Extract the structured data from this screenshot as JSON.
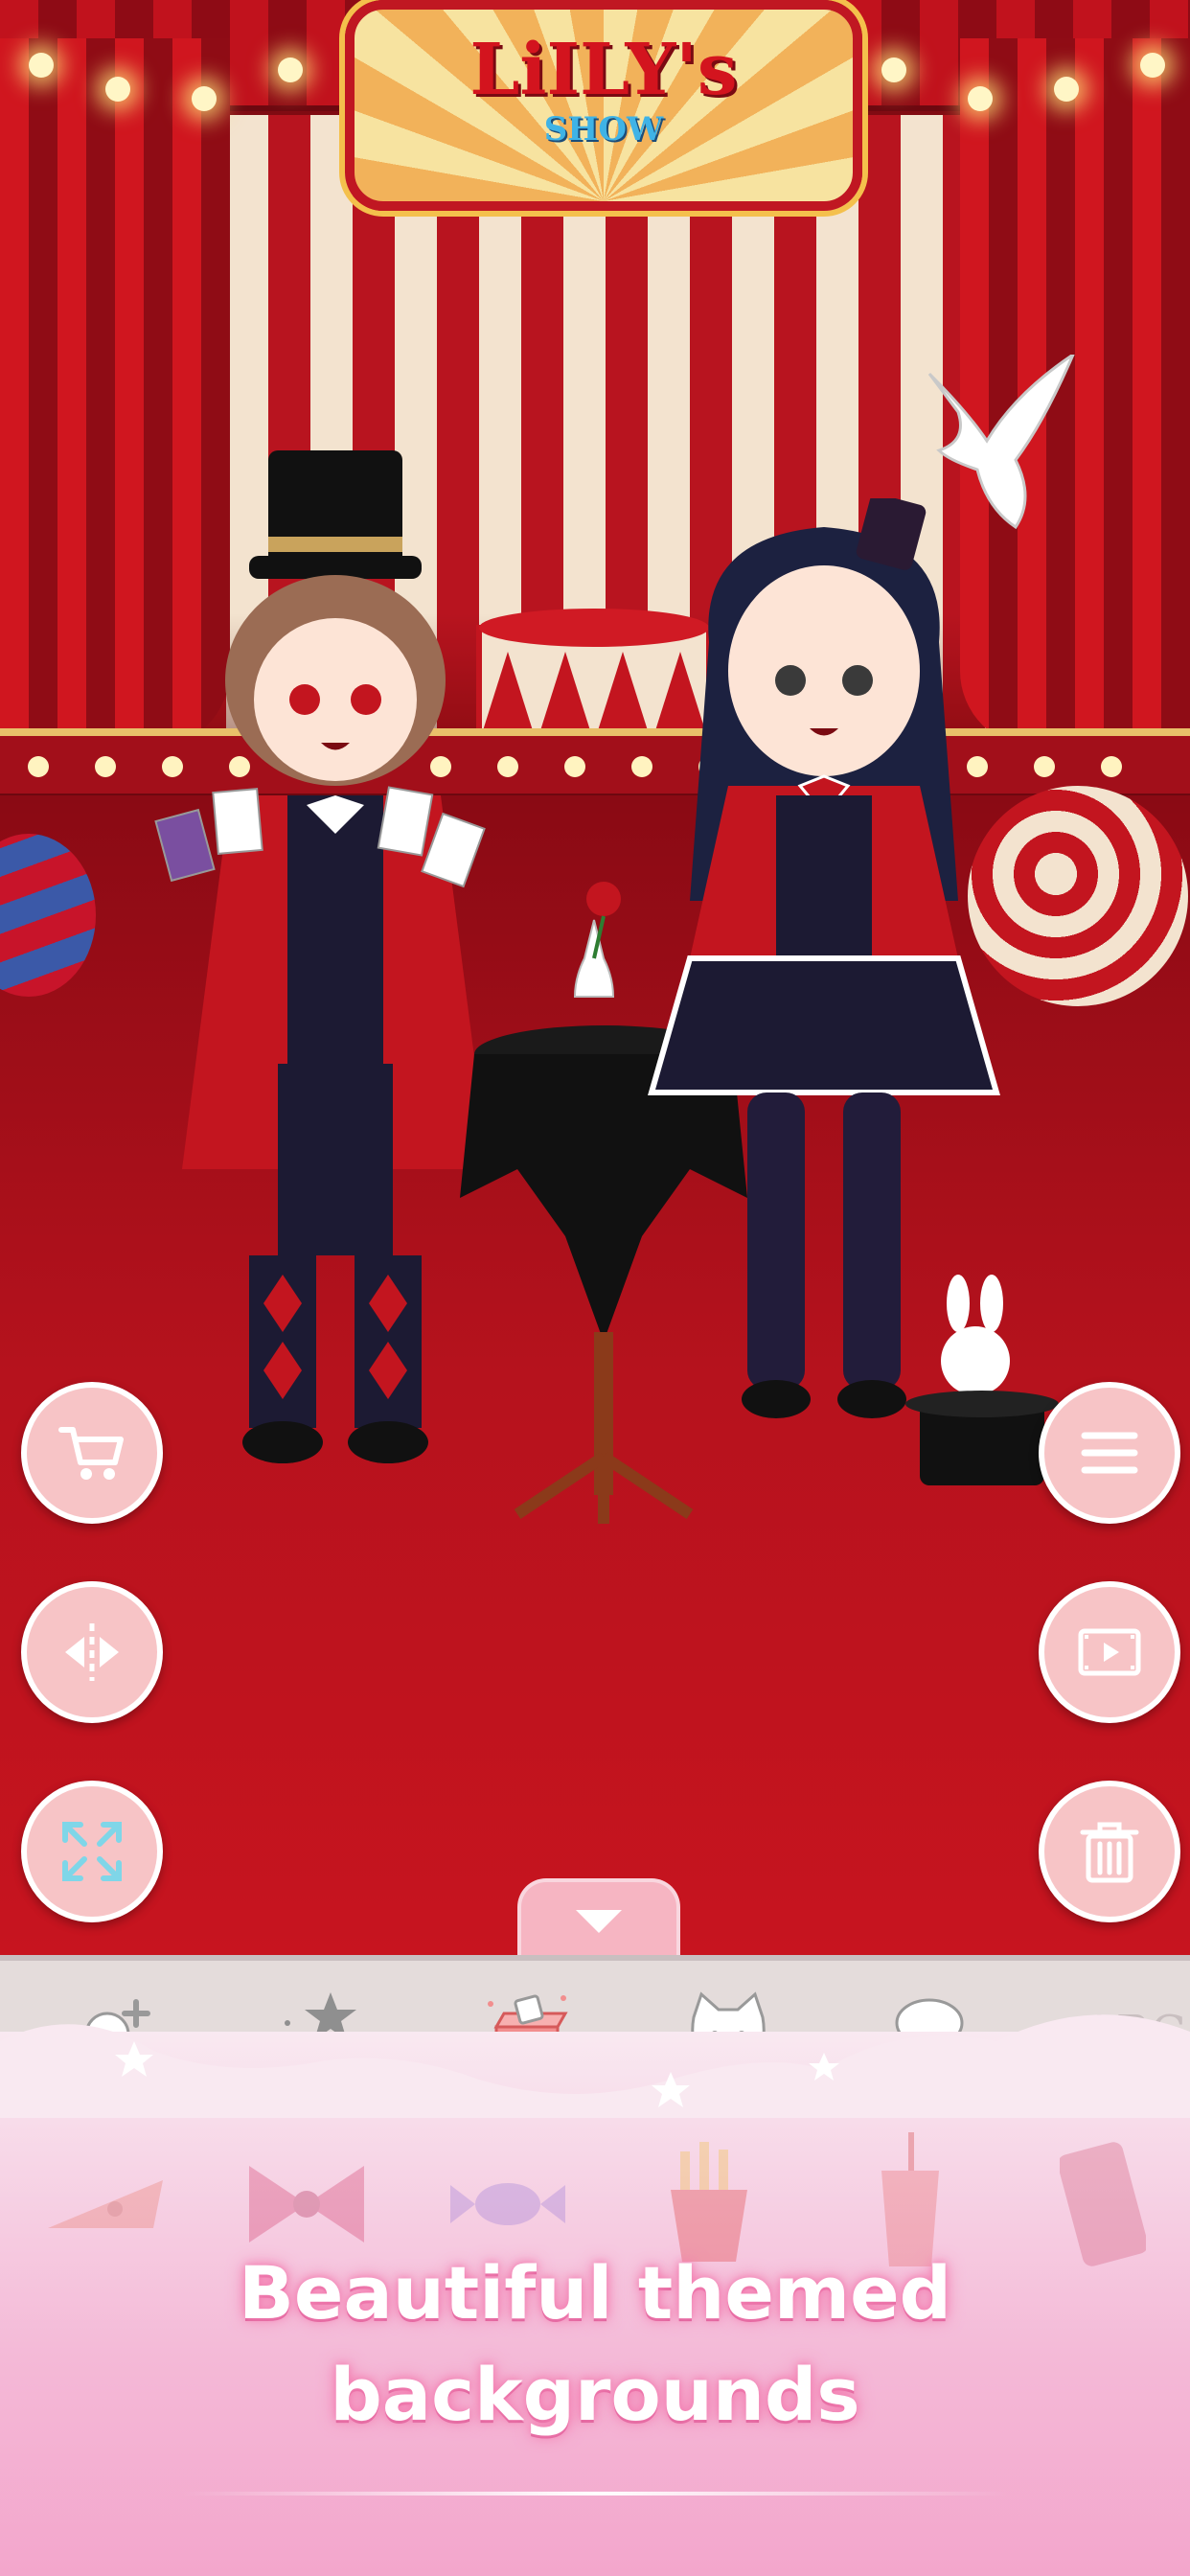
{
  "stage": {
    "sign_title": "LiILY's",
    "sign_subtitle": "SHOW"
  },
  "side_buttons": {
    "left": [
      {
        "name": "shop",
        "icon": "cart-icon"
      },
      {
        "name": "flip",
        "icon": "mirror-flip-icon"
      },
      {
        "name": "expand",
        "icon": "expand-icon"
      }
    ],
    "right": [
      {
        "name": "menu",
        "icon": "hamburger-menu-icon"
      },
      {
        "name": "video",
        "icon": "play-video-icon"
      },
      {
        "name": "delete",
        "icon": "trash-icon"
      }
    ]
  },
  "category_tabs": [
    {
      "icon": "add-character-icon",
      "selected": false
    },
    {
      "icon": "stars-icon",
      "selected": false
    },
    {
      "icon": "gift-box-icon",
      "selected": true
    },
    {
      "icon": "cat-face-icon",
      "selected": false
    },
    {
      "icon": "speech-bubbles-icon",
      "selected": false
    },
    {
      "label": "ABC",
      "icon": "text-icon",
      "selected": false
    }
  ],
  "items": [
    "pizza-icon",
    "bow-icon",
    "candy-icon",
    "fries-icon",
    "drink-cup-icon",
    "phone-icon"
  ],
  "promo": {
    "line1": "Beautiful themed",
    "line2": "backgrounds"
  },
  "colors": {
    "accent_pink": "#f7c4c6",
    "stage_red": "#b5121e",
    "promo_pink": "#f3a6cc"
  }
}
